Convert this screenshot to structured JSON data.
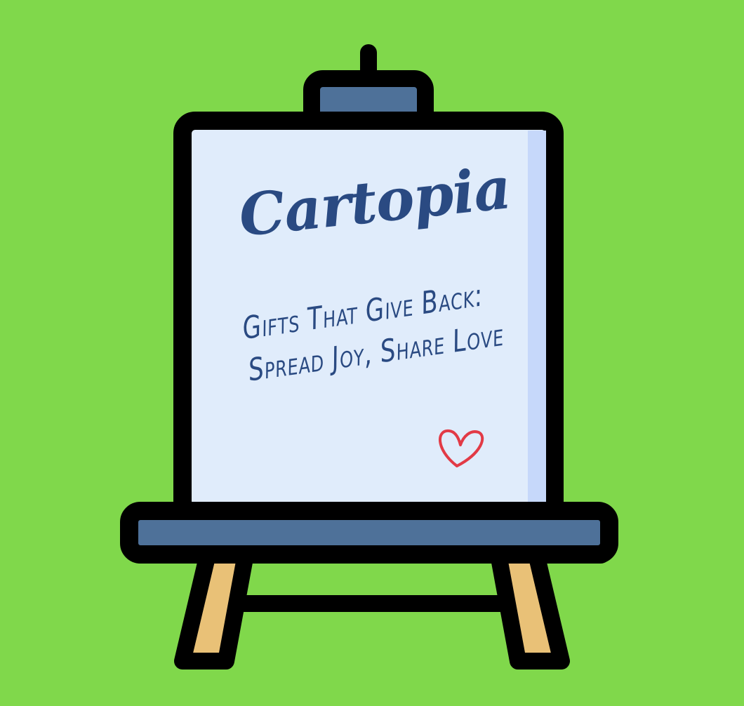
{
  "sign": {
    "brand": "Cartopia",
    "tagline_line1": "Gifts That Give Back:",
    "tagline_line2": "Spread Joy, Share Love"
  },
  "colors": {
    "background": "#80d84b",
    "outline": "#000000",
    "canvas": "#e0ecfb",
    "canvas_shade": "#c6d8fa",
    "frame_blue": "#4e7199",
    "leg_wood": "#e9c177",
    "text": "#2a4a82",
    "heart": "#e23a46"
  },
  "icons": {
    "easel": "easel-icon",
    "heart": "heart-icon"
  }
}
